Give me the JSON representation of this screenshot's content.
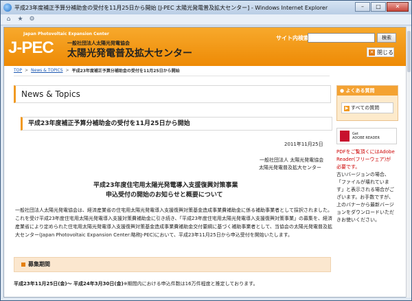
{
  "window": {
    "title": "平成23年度補正予算分補助金の受付を11月25日から開始 [J-PEC 太陽光発電普及拡大センター] - Windows Internet Explorer",
    "minimize": "–",
    "maximize": "□",
    "close": "✕"
  },
  "header": {
    "logo_small": "Japan Photovoltaic Expansion Center",
    "logo_big": "J-PEC",
    "org_small": "一般社団法人太陽光発電協会",
    "org_big": "太陽光発電普及拡大センター",
    "search_label": "サイト内検索",
    "search_value": "",
    "search_button": "検索",
    "close_button": "閉じる"
  },
  "breadcrumb": {
    "items": [
      "TOP",
      "News & TOPICS"
    ],
    "current": "平成23年度補正予算分補助金の受付を11月25日から開始"
  },
  "main": {
    "section_title": "News & Topics",
    "headline": "平成23年度補正予算分補助金の受付を11月25日から開始",
    "date": "2011年11月25日",
    "issuer_line1": "一般社団法人 太陽光発電協会",
    "issuer_line2": "太陽光発電普及拡大センター",
    "doc_title1": "平成23年度住宅用太陽光発電導入支援復興対策事業",
    "doc_title2": "申込受付の開始のお知らせと概要について",
    "body": "一般社団法人太陽光発電協会は、経済産業省の住宅用太陽光発電導入支援復興対策基金造成事業費補助金に係る補助事業者として採択されました。これを受け平成23年度住宅用太陽光発電導入支援対策費補助金に引き続き、「平成23年度住宅用太陽光発電導入支援復興対策事業」の募集を、経済産業省により定められた住宅用太陽光発電導入支援復興対策基金造成事業費補助金交付要綱に基づく補助事業者として、当協会の太陽光発電普及拡大センター(Japan Photovoltaic Expansion Center:略称J-PEC)において、平成23年11月25日から申込受付を開始いたします。",
    "subhead": "募集期間",
    "period_bold": "平成23年11月25日(金)～ 平成24年3月30日(金)",
    "period_rest": "※期間内における申込件数は16万件程度と推定しております。"
  },
  "side": {
    "faq_head": "よくある質問",
    "faq_button": "すべての質問",
    "adobe_line1": "Get",
    "adobe_line2": "ADOBE READER",
    "pdf_note_red": "PDFをご覧頂くにはAdobe Reader(フリーウェア)が必要です。",
    "pdf_note_black": "古いバージョンの場合、「ファイルが壊れています」と表示される場合がございます。お手数ですが、上のバナーから最新バージョンをダウンロードいただきお使いください。"
  },
  "colors": {
    "accent": "#f19a22",
    "link": "#1a56b0",
    "alert": "#cc0000"
  }
}
